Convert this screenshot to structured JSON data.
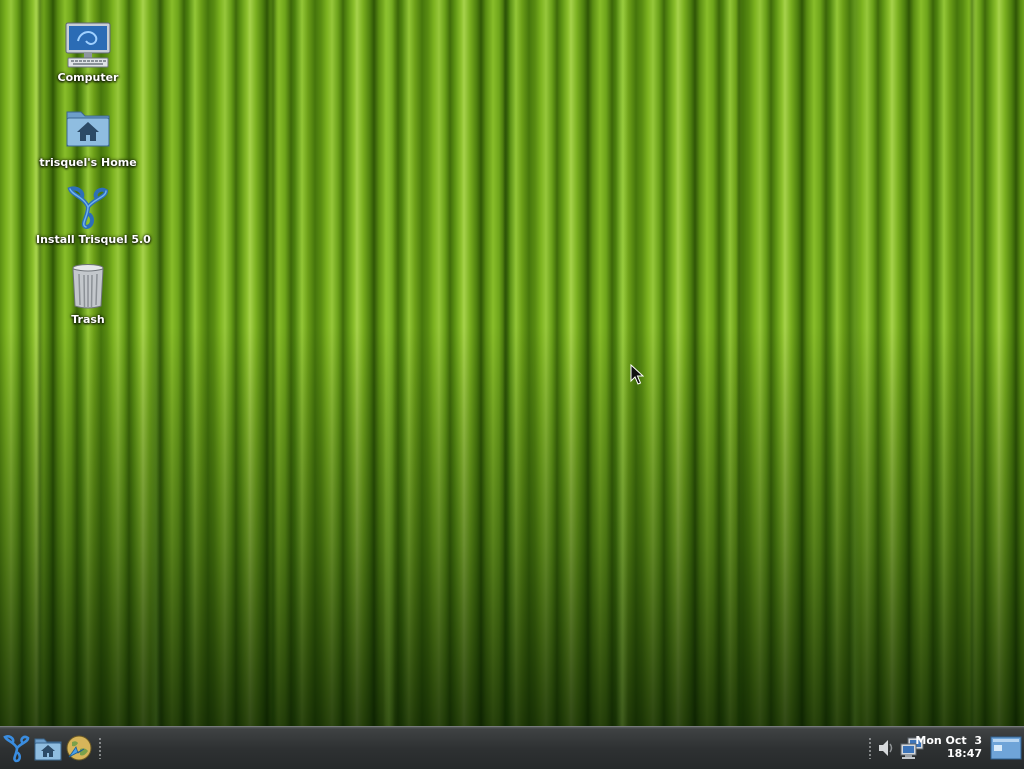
{
  "desktop": {
    "icons": [
      {
        "label": "Computer",
        "icon": "computer-icon"
      },
      {
        "label": "trisquel's Home",
        "icon": "home-folder-icon"
      },
      {
        "label": "Install Trisquel 5.0",
        "icon": "trisquel-installer-icon"
      },
      {
        "label": "Trash",
        "icon": "trash-icon"
      }
    ]
  },
  "taskbar": {
    "launchers": [
      {
        "icon": "trisquel-menu-icon"
      },
      {
        "icon": "home-folder-icon"
      },
      {
        "icon": "web-browser-icon"
      }
    ],
    "tray": [
      {
        "icon": "volume-icon"
      },
      {
        "icon": "network-icon"
      }
    ],
    "clock": {
      "date": "Mon Oct  3",
      "time": "18:47"
    },
    "show_desktop": {
      "icon": "show-desktop-icon"
    }
  },
  "colors": {
    "wallpaper_green": "#7db320",
    "panel": "#2e3132",
    "label_text": "#ffffff"
  }
}
